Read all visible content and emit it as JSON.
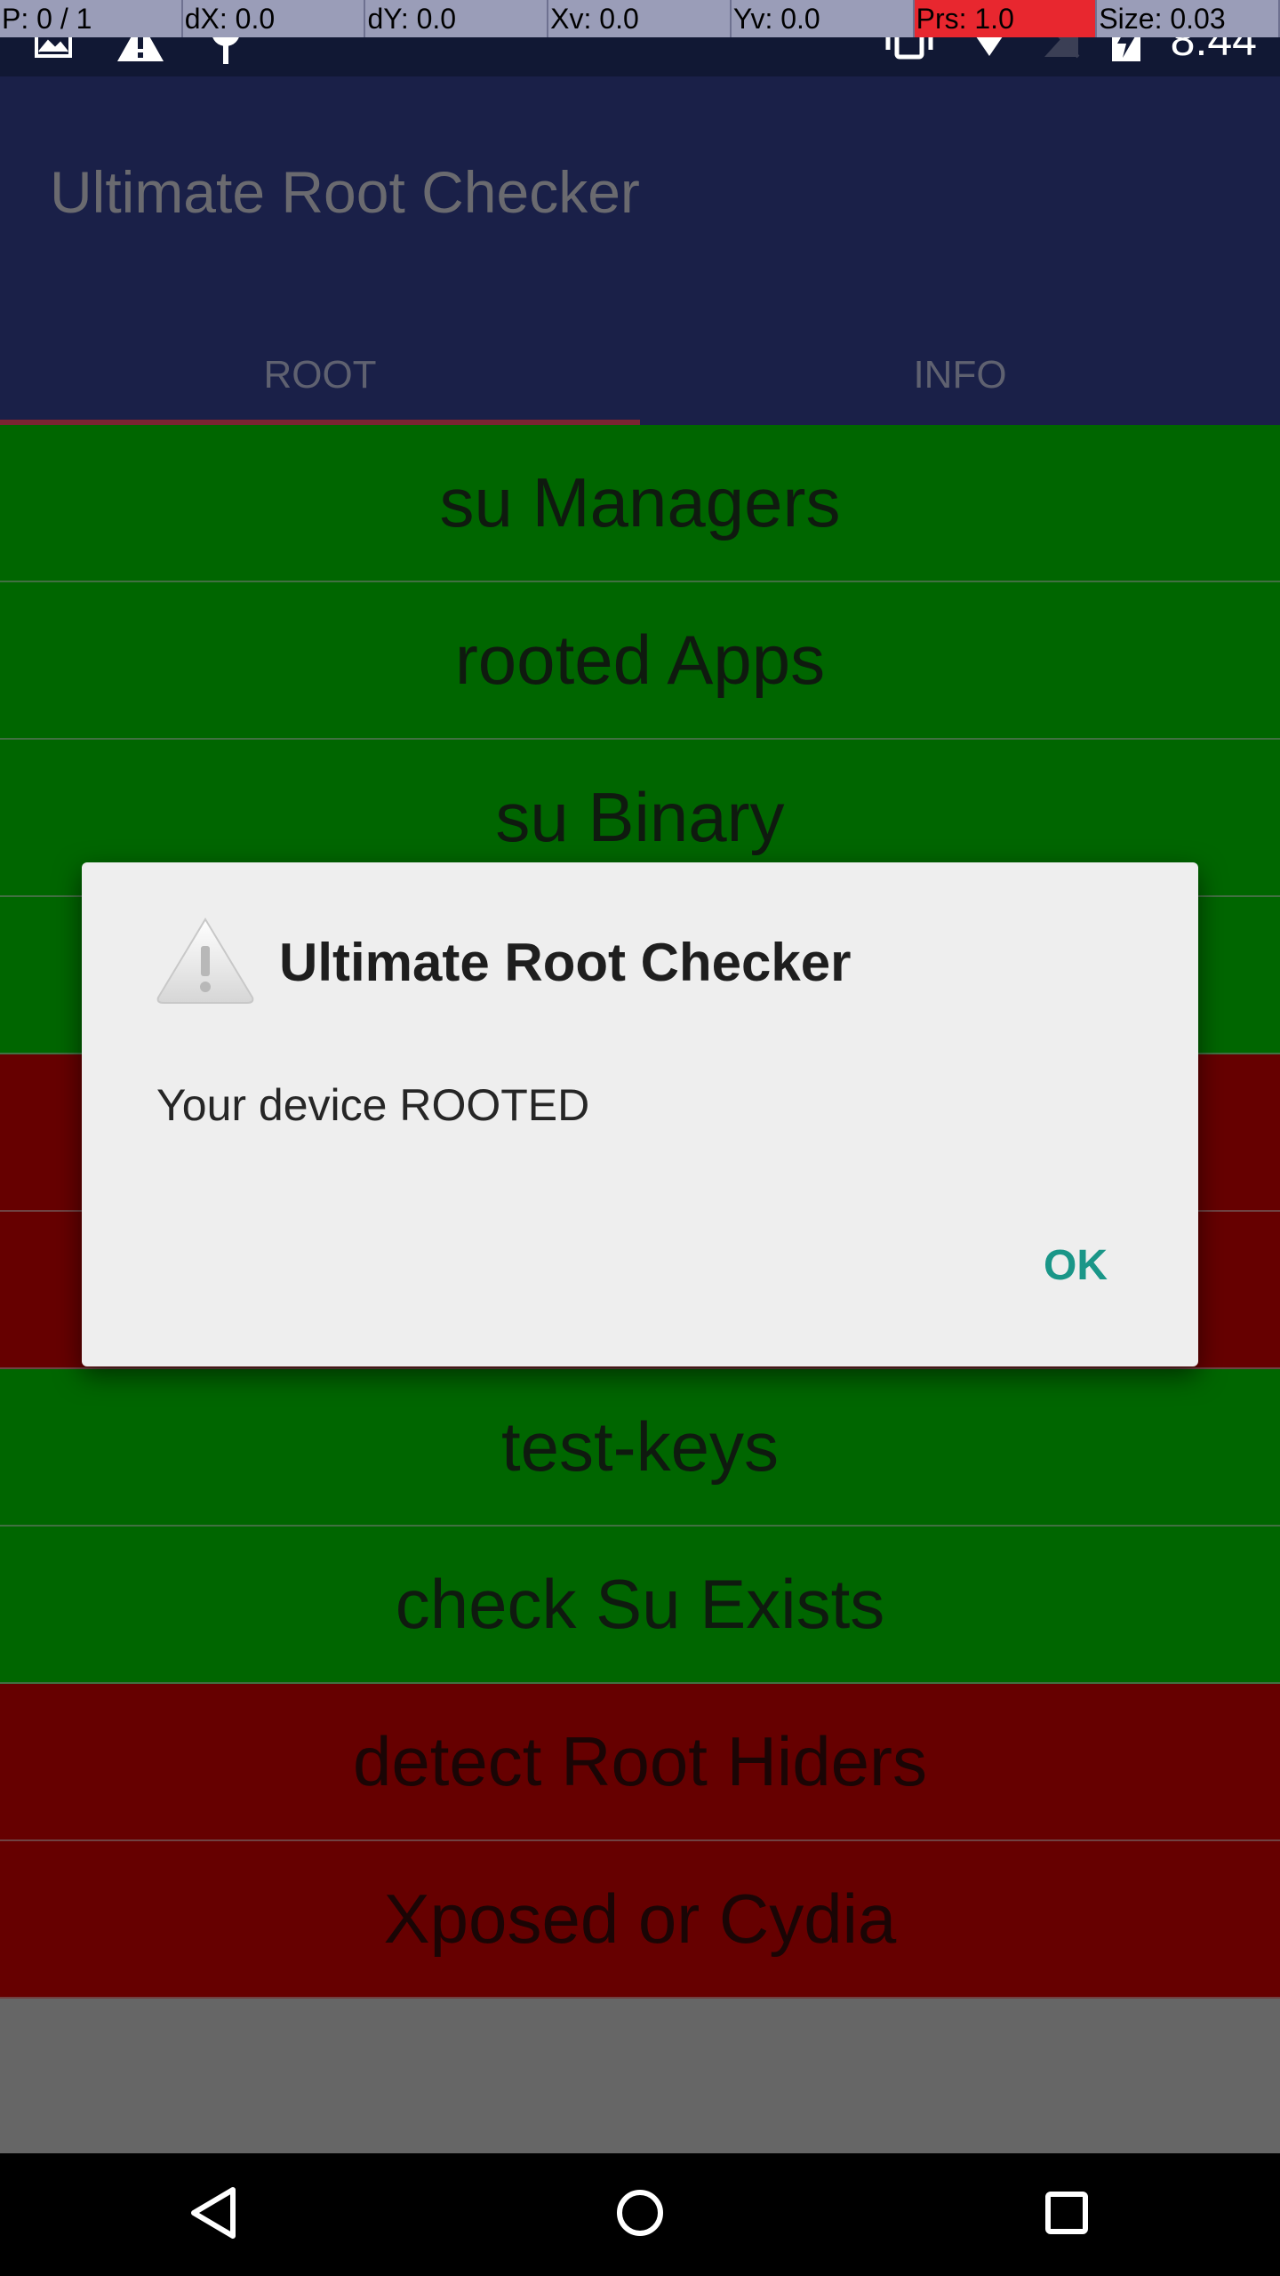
{
  "debug": {
    "cells": [
      "P: 0 / 1",
      "dX: 0.0",
      "dY: 0.0",
      "Xv: 0.0",
      "Yv: 0.0",
      "Prs: 1.0",
      "Size: 0.03"
    ]
  },
  "status_bar": {
    "time": "8:44",
    "left_icons": [
      "image-icon",
      "warning-icon",
      "pin-icon"
    ],
    "right_icons": [
      "vibrate-icon",
      "wifi-icon",
      "no-sim-icon",
      "battery-charging-icon"
    ]
  },
  "app_bar": {
    "title": "Ultimate Root Checker",
    "tabs": [
      {
        "label": "ROOT",
        "selected": true
      },
      {
        "label": "INFO",
        "selected": false
      }
    ]
  },
  "checks": [
    {
      "label": "su Managers",
      "status": "pass"
    },
    {
      "label": "rooted Apps",
      "status": "pass"
    },
    {
      "label": "su Binary",
      "status": "pass"
    },
    {
      "label": "",
      "status": "pass"
    },
    {
      "label": "",
      "status": "fail"
    },
    {
      "label": "",
      "status": "fail"
    },
    {
      "label": "test-keys",
      "status": "pass"
    },
    {
      "label": "check Su Exists",
      "status": "pass"
    },
    {
      "label": "detect Root Hiders",
      "status": "fail"
    },
    {
      "label": "Xposed or Cydia",
      "status": "fail"
    }
  ],
  "dialog": {
    "icon": "warning-icon",
    "title": "Ultimate Root Checker",
    "message": "Your device ROOTED",
    "ok_label": "OK"
  },
  "colors": {
    "pass": "#006600",
    "fail": "#660000",
    "app_bar": "#1a2048",
    "accent": "#1a9688"
  },
  "nav": {
    "icons": [
      "back-icon",
      "home-icon",
      "recents-icon"
    ]
  }
}
